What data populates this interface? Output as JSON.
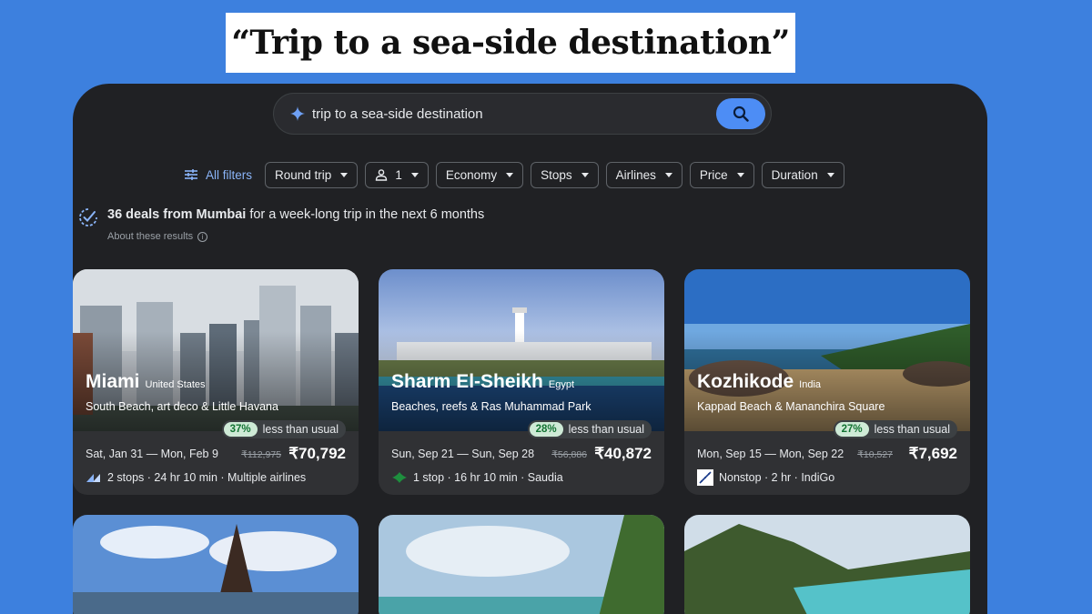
{
  "banner": {
    "title": "“Trip to a sea-side destination”"
  },
  "search": {
    "value": "trip to a sea-side destination"
  },
  "filters": {
    "all_label": "All filters",
    "trip_type": "Round trip",
    "passengers": "1",
    "cabin": "Economy",
    "stops": "Stops",
    "airlines": "Airlines",
    "price": "Price",
    "duration": "Duration"
  },
  "summary": {
    "bold": "36 deals from Mumbai",
    "rest": " for a week-long trip in the next 6 months",
    "about": "About these results"
  },
  "cards": [
    {
      "city": "Miami",
      "country": "United States",
      "subtitle": "South Beach, art deco & Little Havana",
      "badge": "37%",
      "badge_text": "less than usual",
      "dates": "Sat, Jan 31 — Mon, Feb 9",
      "old_price": "₹112,975",
      "price": "₹70,792",
      "flight": "2 stops · 24 hr 10 min · Multiple airlines"
    },
    {
      "city": "Sharm El-Sheikh",
      "country": "Egypt",
      "subtitle": "Beaches, reefs & Ras Muhammad Park",
      "badge": "28%",
      "badge_text": "less than usual",
      "dates": "Sun, Sep 21 — Sun, Sep 28",
      "old_price": "₹56,886",
      "price": "₹40,872",
      "flight": "1 stop · 16 hr 10 min · Saudia"
    },
    {
      "city": "Kozhikode",
      "country": "India",
      "subtitle": "Kappad Beach & Mananchira Square",
      "badge": "27%",
      "badge_text": "less than usual",
      "dates": "Mon, Sep 15 — Mon, Sep 22",
      "old_price": "₹10,527",
      "price": "₹7,692",
      "flight": "Nonstop · 2 hr · IndiGo"
    }
  ]
}
